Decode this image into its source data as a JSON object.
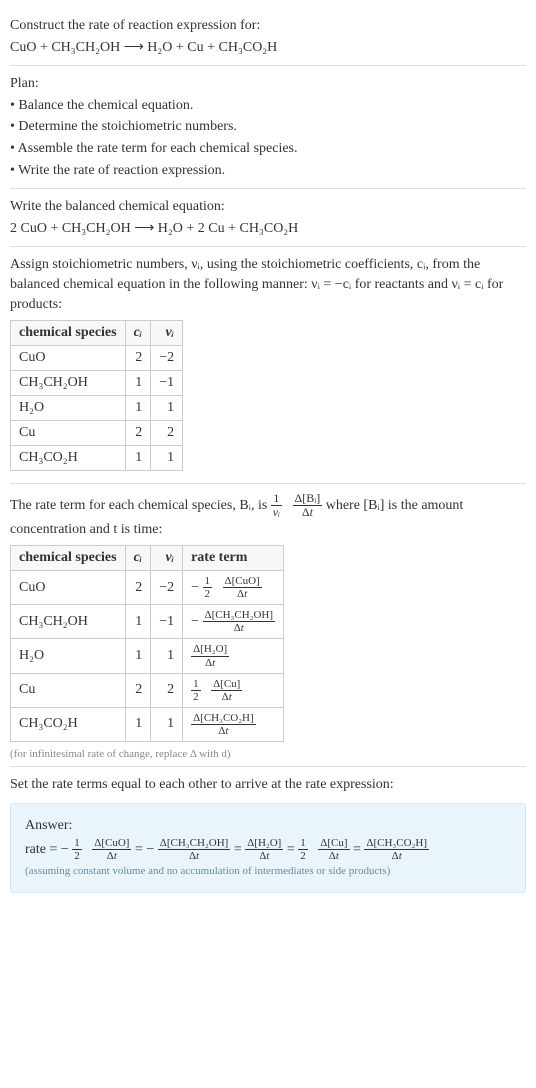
{
  "intro": {
    "prompt": "Construct the rate of reaction expression for:",
    "equation": "CuO + CH₃CH₂OH ⟶ H₂O + Cu + CH₃CO₂H"
  },
  "plan": {
    "heading": "Plan:",
    "b1": "• Balance the chemical equation.",
    "b2": "• Determine the stoichiometric numbers.",
    "b3": "• Assemble the rate term for each chemical species.",
    "b4": "• Write the rate of reaction expression."
  },
  "balanced": {
    "heading": "Write the balanced chemical equation:",
    "equation": "2 CuO + CH₃CH₂OH ⟶ H₂O + 2 Cu + CH₃CO₂H"
  },
  "stoich": {
    "text1": "Assign stoichiometric numbers, νᵢ, using the stoichiometric coefficients, cᵢ, from the balanced chemical equation in the following manner: νᵢ = −cᵢ for reactants and νᵢ = cᵢ for products:",
    "h_species": "chemical species",
    "h_c": "cᵢ",
    "h_v": "νᵢ",
    "r1_sp": "CuO",
    "r1_c": "2",
    "r1_v": "−2",
    "r2_sp": "CH₃CH₂OH",
    "r2_c": "1",
    "r2_v": "−1",
    "r3_sp": "H₂O",
    "r3_c": "1",
    "r3_v": "1",
    "r4_sp": "Cu",
    "r4_c": "2",
    "r4_v": "2",
    "r5_sp": "CH₃CO₂H",
    "r5_c": "1",
    "r5_v": "1"
  },
  "rate_term": {
    "text_a": "The rate term for each chemical species, Bᵢ, is ",
    "text_b": " where [Bᵢ] is the amount concentration and t is time:",
    "h_species": "chemical species",
    "h_c": "cᵢ",
    "h_v": "νᵢ",
    "h_rate": "rate term",
    "r1_sp": "CuO",
    "r1_c": "2",
    "r1_v": "−2",
    "r2_sp": "CH₃CH₂OH",
    "r2_c": "1",
    "r2_v": "−1",
    "r3_sp": "H₂O",
    "r3_c": "1",
    "r3_v": "1",
    "r4_sp": "Cu",
    "r4_c": "2",
    "r4_v": "2",
    "r5_sp": "CH₃CO₂H",
    "r5_c": "1",
    "r5_v": "1",
    "foot": "(for infinitesimal rate of change, replace Δ with d)"
  },
  "final": {
    "heading": "Set the rate terms equal to each other to arrive at the rate expression:",
    "answer_label": "Answer:",
    "rate_word": "rate = ",
    "assumption": "(assuming constant volume and no accumulation of intermediates or side products)"
  },
  "math": {
    "one": "1",
    "two": "2",
    "vi": "νᵢ",
    "dBi_num": "Δ[Bᵢ]",
    "dt": "Δt",
    "neg": "−",
    "eq": " = ",
    "dCuO": "Δ[CuO]",
    "dEtOH": "Δ[CH₃CH₂OH]",
    "dH2O": "Δ[H₂O]",
    "dCu": "Δ[Cu]",
    "dAcOH": "Δ[CH₃CO₂H]"
  },
  "chart_data": {
    "type": "table",
    "tables": [
      {
        "title": "Stoichiometric numbers",
        "columns": [
          "chemical species",
          "cᵢ",
          "νᵢ"
        ],
        "rows": [
          [
            "CuO",
            2,
            -2
          ],
          [
            "CH₃CH₂OH",
            1,
            -1
          ],
          [
            "H₂O",
            1,
            1
          ],
          [
            "Cu",
            2,
            2
          ],
          [
            "CH₃CO₂H",
            1,
            1
          ]
        ]
      },
      {
        "title": "Rate terms",
        "columns": [
          "chemical species",
          "cᵢ",
          "νᵢ",
          "rate term"
        ],
        "rows": [
          [
            "CuO",
            2,
            -2,
            "−(1/2)·Δ[CuO]/Δt"
          ],
          [
            "CH₃CH₂OH",
            1,
            -1,
            "−Δ[CH₃CH₂OH]/Δt"
          ],
          [
            "H₂O",
            1,
            1,
            "Δ[H₂O]/Δt"
          ],
          [
            "Cu",
            2,
            2,
            "(1/2)·Δ[Cu]/Δt"
          ],
          [
            "CH₃CO₂H",
            1,
            1,
            "Δ[CH₃CO₂H]/Δt"
          ]
        ]
      }
    ]
  }
}
